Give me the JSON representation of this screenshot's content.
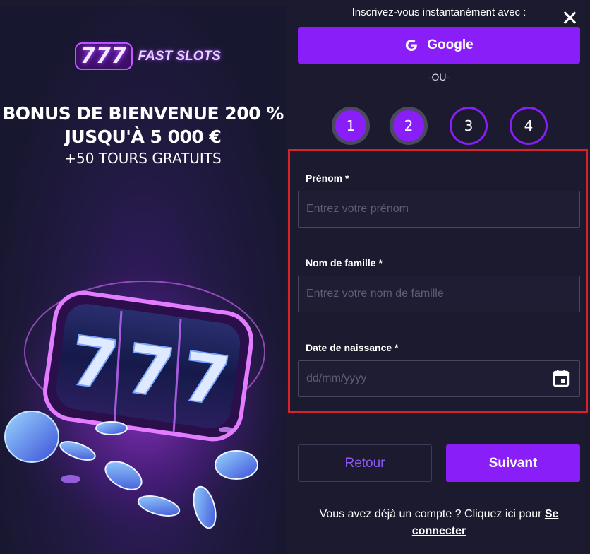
{
  "promo": {
    "logo_number": "777",
    "logo_name": "FAST SLOTS",
    "headline_line1": "BONUS DE BIENVENUE 200 %",
    "headline_line2": "JUSQU'À 5 000 €",
    "subline": "+50 TOURS GRATUITS"
  },
  "signup": {
    "instant_label": "Inscrivez-vous instantanément avec :",
    "google_label": "Google",
    "or_label": "-OU-"
  },
  "steps": [
    {
      "label": "1",
      "state": "done"
    },
    {
      "label": "2",
      "state": "done"
    },
    {
      "label": "3",
      "state": "todo"
    },
    {
      "label": "4",
      "state": "todo"
    }
  ],
  "form": {
    "first_name": {
      "label": "Prénom *",
      "placeholder": "Entrez votre prénom",
      "value": ""
    },
    "last_name": {
      "label": "Nom de famille *",
      "placeholder": "Entrez votre nom de famille",
      "value": ""
    },
    "birth_date": {
      "label": "Date de naissance *",
      "placeholder": "dd/mm/yyyy",
      "value": ""
    }
  },
  "actions": {
    "back_label": "Retour",
    "next_label": "Suivant"
  },
  "footer": {
    "text": "Vous avez déjà un compte ? Cliquez ici pour ",
    "link_label": "Se connecter"
  },
  "colors": {
    "accent": "#8a1ef8",
    "background": "#1b1a2e",
    "highlight_border": "#d8212a"
  }
}
